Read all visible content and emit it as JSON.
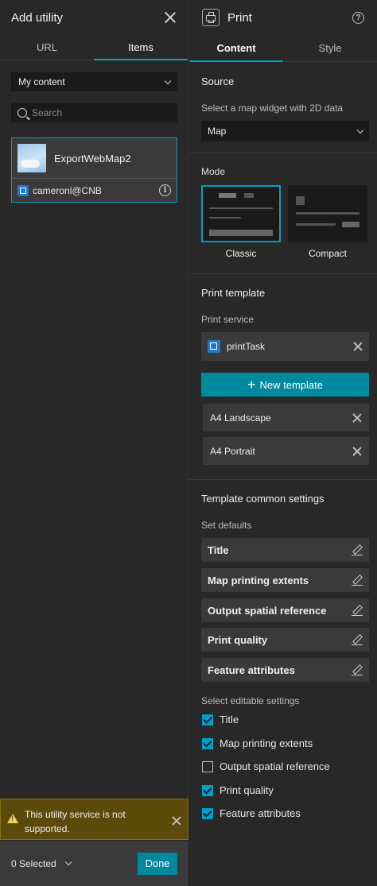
{
  "left_panel": {
    "title": "Add utility",
    "tabs": [
      {
        "label": "URL",
        "active": false
      },
      {
        "label": "Items",
        "active": true
      }
    ],
    "filter_dropdown": {
      "value": "My content"
    },
    "search": {
      "placeholder": "Search",
      "value": ""
    },
    "item": {
      "name": "ExportWebMap2",
      "owner": "cameronl@CNB",
      "selected": true
    },
    "warning": {
      "text": "This utility service is not supported."
    },
    "footer": {
      "selected_count_label": "0 Selected",
      "done_label": "Done"
    }
  },
  "right_panel": {
    "title": "Print",
    "tabs": [
      {
        "label": "Content",
        "active": true
      },
      {
        "label": "Style",
        "active": false
      }
    ],
    "source": {
      "title": "Source",
      "subtitle": "Select a map widget with 2D data",
      "map_select_value": "Map"
    },
    "mode": {
      "title": "Mode",
      "options": [
        {
          "label": "Classic",
          "selected": true
        },
        {
          "label": "Compact",
          "selected": false
        }
      ]
    },
    "print_template": {
      "title": "Print template",
      "service_label": "Print service",
      "service_name": "printTask",
      "new_template_label": "New template",
      "templates": [
        "A4 Landscape",
        "A4 Portrait"
      ]
    },
    "common_settings": {
      "title": "Template common settings",
      "defaults_label": "Set defaults",
      "defaults": [
        "Title",
        "Map printing extents",
        "Output spatial reference",
        "Print quality",
        "Feature attributes"
      ],
      "editable_label": "Select editable settings",
      "editable": [
        {
          "label": "Title",
          "checked": true
        },
        {
          "label": "Map printing extents",
          "checked": true
        },
        {
          "label": "Output spatial reference",
          "checked": false
        },
        {
          "label": "Print quality",
          "checked": true
        },
        {
          "label": "Feature attributes",
          "checked": true
        }
      ]
    }
  },
  "colors": {
    "accent": "#00a0c8",
    "button": "#00889e",
    "warning_bg": "#5c4a0a",
    "panel_bg": "#282828"
  },
  "icons": [
    "close-icon",
    "chevron-down-icon",
    "search-icon",
    "info-icon",
    "org-icon",
    "warning-icon",
    "printer-icon",
    "help-icon",
    "plus-icon",
    "pencil-icon",
    "checkbox-icon"
  ]
}
